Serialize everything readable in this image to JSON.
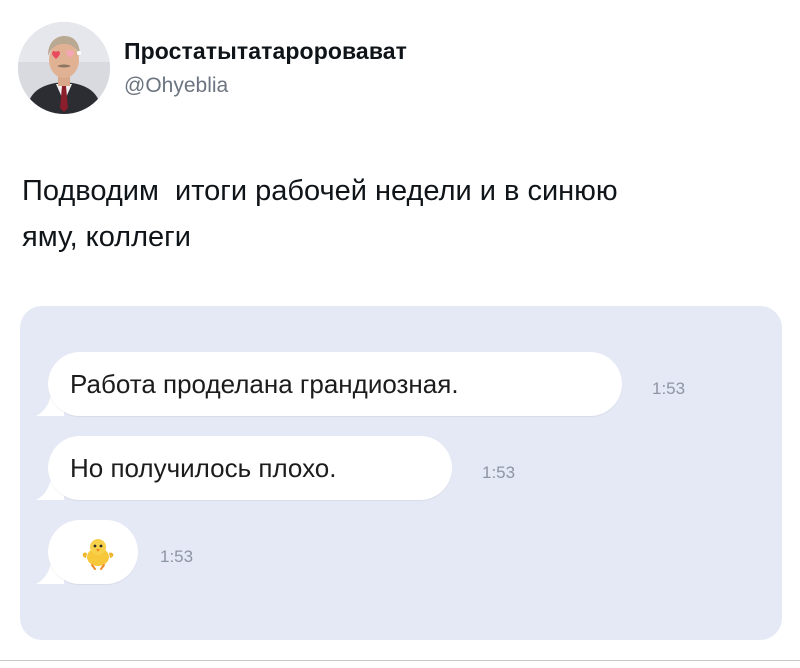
{
  "tweet": {
    "author": {
      "display_name": "Простатытатароровават",
      "handle": "@Ohyeblia",
      "avatar_icon": "profile-photo-avatar"
    },
    "text": "Подводим  итоги рабочей недели и в синюю\nяму, коллеги"
  },
  "chat": {
    "background_color": "#e4e9f5",
    "bubble_color": "#ffffff",
    "messages": [
      {
        "text": "Работа проделана грандиозная.",
        "time": "1:53"
      },
      {
        "text": "Но получилось плохо.",
        "time": "1:53"
      },
      {
        "emoji": "baby-chick-emoji",
        "time": "1:53"
      }
    ]
  }
}
